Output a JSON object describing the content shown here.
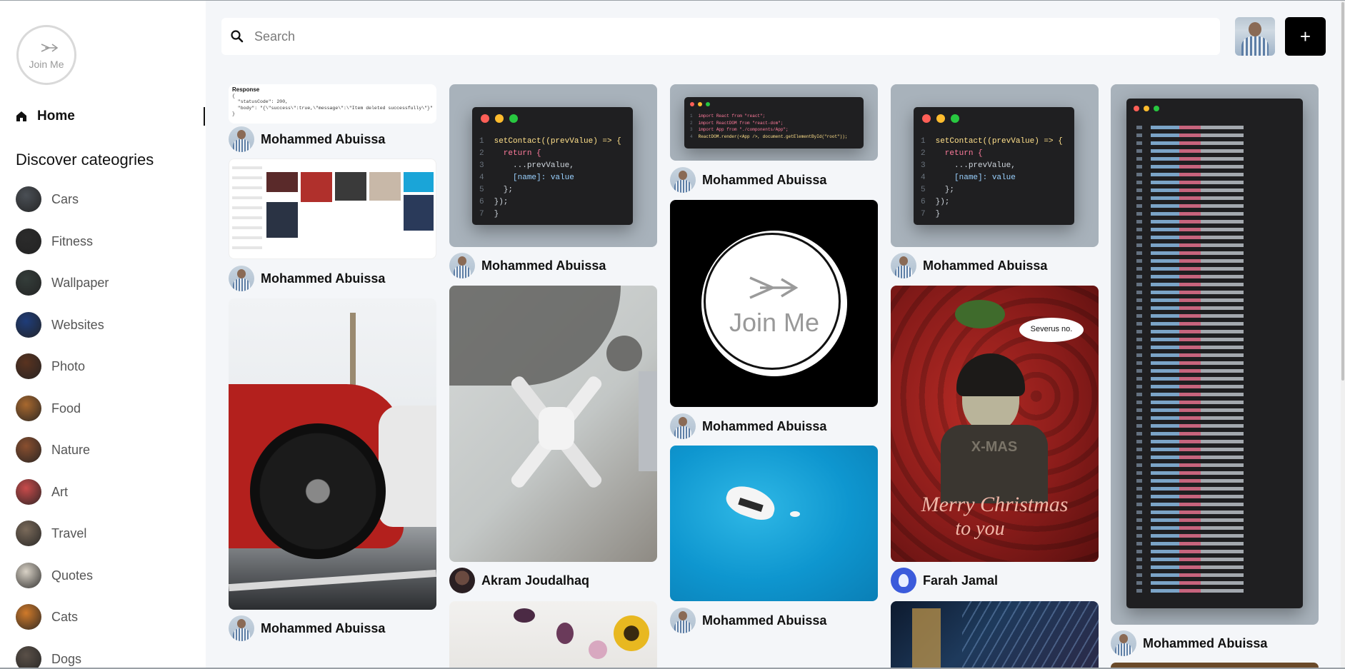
{
  "sidebar": {
    "logo_text": "Join Me",
    "home_label": "Home",
    "discover_title": "Discover cateogries",
    "categories": [
      {
        "label": "Cars",
        "color": "#4a4f55"
      },
      {
        "label": "Fitness",
        "color": "#2b2b2b"
      },
      {
        "label": "Wallpaper",
        "color": "#343d3a"
      },
      {
        "label": "Websites",
        "color": "#1f3d7a"
      },
      {
        "label": "Photo",
        "color": "#5a3320"
      },
      {
        "label": "Food",
        "color": "#a8682e"
      },
      {
        "label": "Nature",
        "color": "#8a4f2f"
      },
      {
        "label": "Art",
        "color": "#c94b4b"
      },
      {
        "label": "Travel",
        "color": "#7a6a5a"
      },
      {
        "label": "Quotes",
        "color": "#d9d2c6"
      },
      {
        "label": "Cats",
        "color": "#d07a2a"
      },
      {
        "label": "Dogs",
        "color": "#5a5048"
      }
    ]
  },
  "header": {
    "search_placeholder": "Search",
    "add_label": "+"
  },
  "pins": {
    "p1": {
      "author": "Mohammed Abuissa",
      "heading": "Response",
      "body": "{\n  \"statusCode\": 200,\n  \"body\": \"{\\\"success\\\":true,\\\"message\\\":\\\"Item deleted successfully\\\"}\"\n}"
    },
    "p2": {
      "author": "Mohammed Abuissa"
    },
    "p3": {
      "author": "Mohammed Abuissa"
    },
    "p4": {
      "author": "Mohammed Abuissa"
    },
    "p5": {
      "author": "Akram Joudalhaq"
    },
    "p7": {
      "author": "Mohammed Abuissa"
    },
    "p8": {
      "author": "Mohammed Abuissa",
      "logo_text": "Join Me"
    },
    "p9": {
      "author": "Mohammed Abuissa"
    },
    "p10": {
      "author": "Mohammed Abuissa"
    },
    "p11": {
      "author": "Farah Jamal",
      "bubble": "Severus no.",
      "line1": "Merry Christmas",
      "line2": "to you",
      "sweater": "X-MAS"
    },
    "p13": {
      "author": "Mohammed Abuissa"
    }
  },
  "code_snippets": {
    "set_contact": [
      "setContact((prevValue) => {",
      "  return {",
      "    ...prevValue,",
      "    [name]: value",
      "  };",
      "});",
      "}"
    ],
    "imports": [
      "import React from \"react\";",
      "import ReactDOM from \"react-dom\";",
      "import App from \"./components/App\";",
      "ReactDOM.render(<App />, document.getElementById(\"root\"));"
    ]
  },
  "colors": {
    "accent": "#000000",
    "dot_red": "#ff5f57",
    "dot_yellow": "#febc2e",
    "dot_green": "#28c840"
  }
}
